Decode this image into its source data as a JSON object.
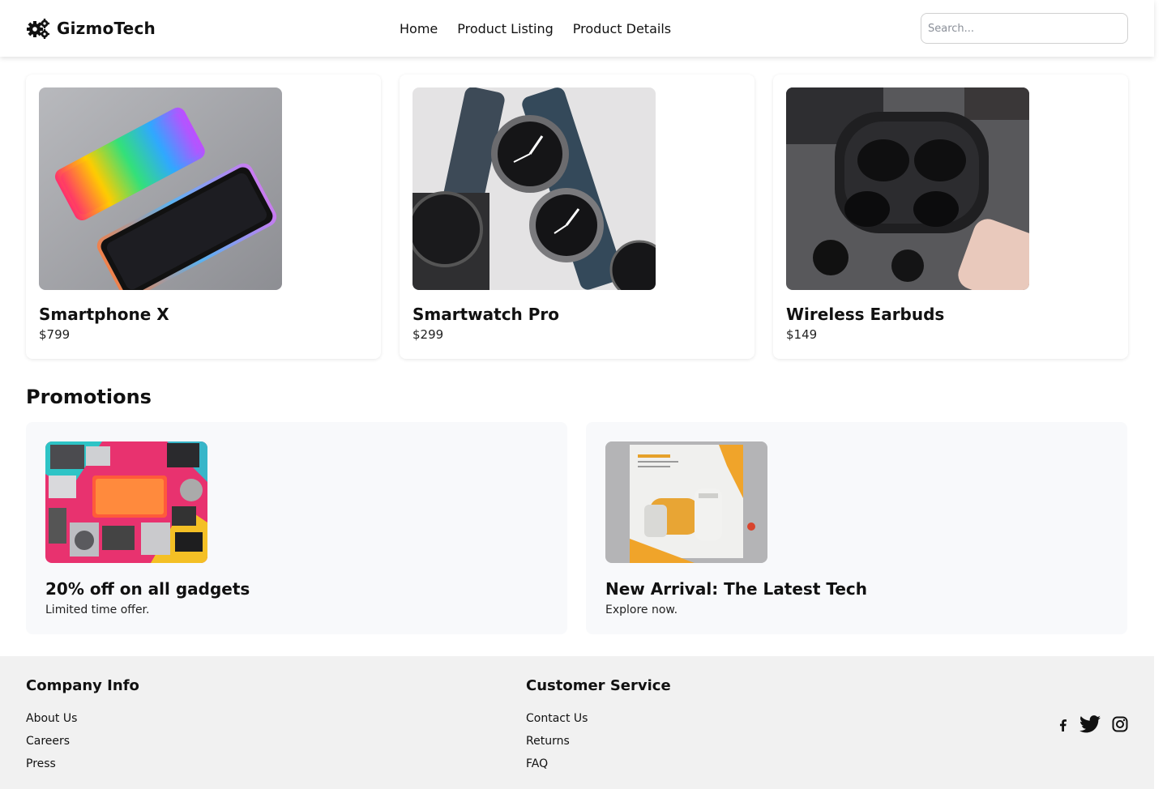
{
  "header": {
    "logo_text": "GizmoTech",
    "logo_icon": "gears-icon",
    "nav": [
      "Home",
      "Product Listing",
      "Product Details"
    ],
    "search_placeholder": "Search..."
  },
  "products": [
    {
      "name": "Smartphone X",
      "price": "$799",
      "image": "smartphone-image"
    },
    {
      "name": "Smartwatch Pro",
      "price": "$299",
      "image": "smartwatch-image"
    },
    {
      "name": "Wireless Earbuds",
      "price": "$149",
      "image": "earbuds-image"
    }
  ],
  "promotions": {
    "title": "Promotions",
    "items": [
      {
        "heading": "20% off on all gadgets",
        "subtext": "Limited time offer.",
        "image": "gadgets-sale-image"
      },
      {
        "heading": "New Arrival: The Latest Tech",
        "subtext": "Explore now.",
        "image": "new-arrival-image"
      }
    ]
  },
  "footer": {
    "company": {
      "title": "Company Info",
      "links": [
        "About Us",
        "Careers",
        "Press"
      ]
    },
    "service": {
      "title": "Customer Service",
      "links": [
        "Contact Us",
        "Returns",
        "FAQ"
      ]
    },
    "social": [
      "facebook-icon",
      "twitter-icon",
      "instagram-icon"
    ]
  },
  "colors": {
    "accent": "#111111",
    "footer_bg": "#f1f1f1",
    "promo_bg": "#f8f9fb"
  }
}
